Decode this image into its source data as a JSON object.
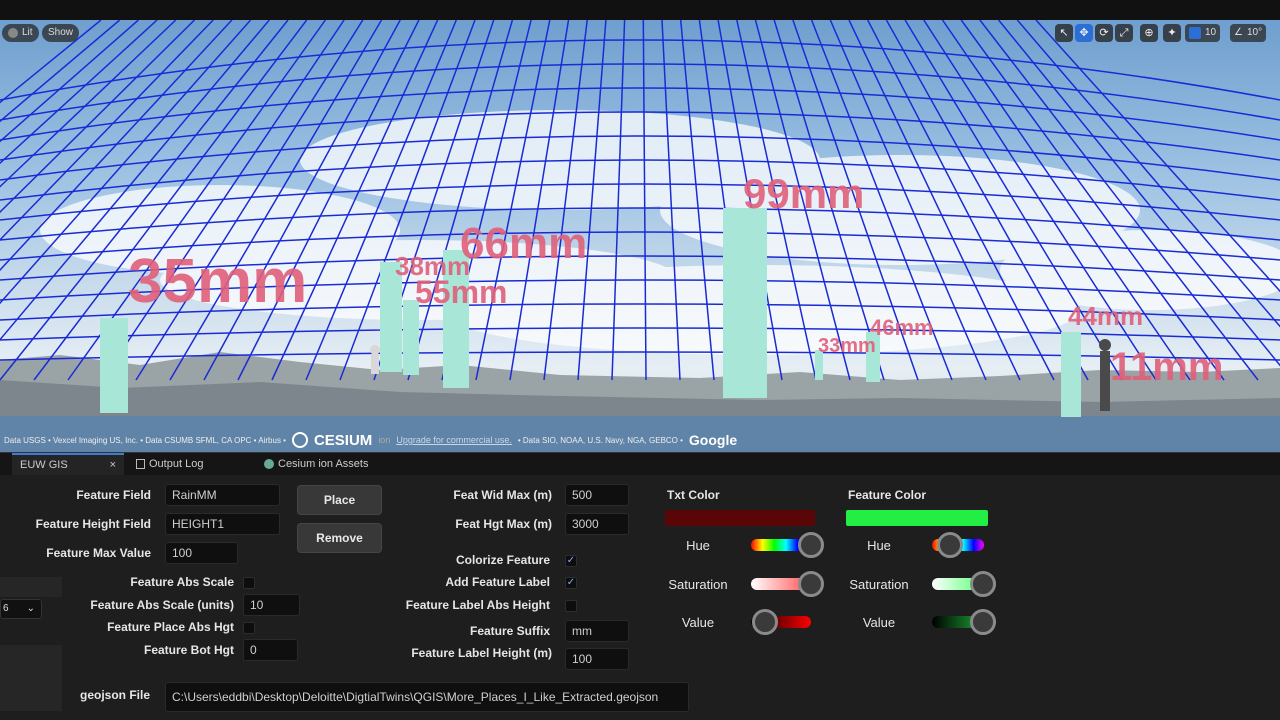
{
  "viewport": {
    "pill_lit": "Lit",
    "pill_show": "Show",
    "grid_snap_value": "10",
    "rotation_snap_value": "10°",
    "labels": [
      "35mm",
      "38mm",
      "55mm",
      "66mm",
      "99mm",
      "33mm",
      "46mm",
      "44mm",
      "11mm"
    ],
    "label_color": "#e0607a",
    "column_color": "#a8e6d8",
    "grid_color": "#1a2bd6",
    "attribution_left": "Data USGS • Vexcel Imaging US, Inc. • Data CSUMB SFML, CA OPC • Airbus •",
    "cesium_logo": "CESIUM",
    "cesium_ion": "ion",
    "upgrade_link": "Upgrade for commercial use.",
    "attribution_right": "• Data SIO, NOAA, U.S. Navy, NGA, GEBCO •",
    "google_logo": "Google"
  },
  "tabs": [
    {
      "label": "EUW GIS",
      "close": "×"
    },
    {
      "label": "Output Log"
    },
    {
      "label": "Cesium ion Assets"
    }
  ],
  "form": {
    "feature_field_label": "Feature Field",
    "feature_field_value": "RainMM",
    "feature_height_field_label": "Feature Height Field",
    "feature_height_field_value": "HEIGHT1",
    "feature_max_value_label": "Feature Max Value",
    "feature_max_value_value": "100",
    "feature_abs_scale_label": "Feature Abs Scale",
    "feature_abs_scale_units_label": "Feature Abs Scale (units)",
    "feature_abs_scale_units_value": "10",
    "feature_place_abs_hgt_label": "Feature Place Abs Hgt",
    "feature_bot_hgt_label": "Feature Bot Hgt",
    "feature_bot_hgt_value": "0",
    "place_button": "Place",
    "remove_button": "Remove",
    "feat_wid_max_label": "Feat Wid Max (m)",
    "feat_wid_max_value": "500",
    "feat_hgt_max_label": "Feat Hgt Max (m)",
    "feat_hgt_max_value": "3000",
    "colorize_feature_label": "Colorize Feature",
    "add_feature_label_label": "Add Feature Label",
    "feature_label_abs_height_label": "Feature Label Abs Height",
    "feature_suffix_label": "Feature Suffix",
    "feature_suffix_value": "mm",
    "feature_label_height_label": "Feature Label Height (m)",
    "feature_label_height_value": "100",
    "geojson_file_label": "geojson File",
    "geojson_file_value": "C:\\Users\\eddbi\\Desktop\\Deloitte\\DigtialTwins\\QGIS\\More_Places_I_Like_Extracted.geojson",
    "side_dropdown_value": "6",
    "colorize_checked": true,
    "add_label_checked": true
  },
  "txt_color": {
    "title": "Txt Color",
    "swatch": "#5a0606",
    "hue_label": "Hue",
    "hue": 0.85,
    "saturation_label": "Saturation",
    "saturation": 0.85,
    "value_label": "Value",
    "value": 0.2
  },
  "feature_color": {
    "title": "Feature Color",
    "swatch": "#22ee44",
    "hue_label": "Hue",
    "hue": 0.35,
    "saturation_label": "Saturation",
    "saturation": 0.8,
    "value_label": "Value",
    "value": 0.8
  }
}
